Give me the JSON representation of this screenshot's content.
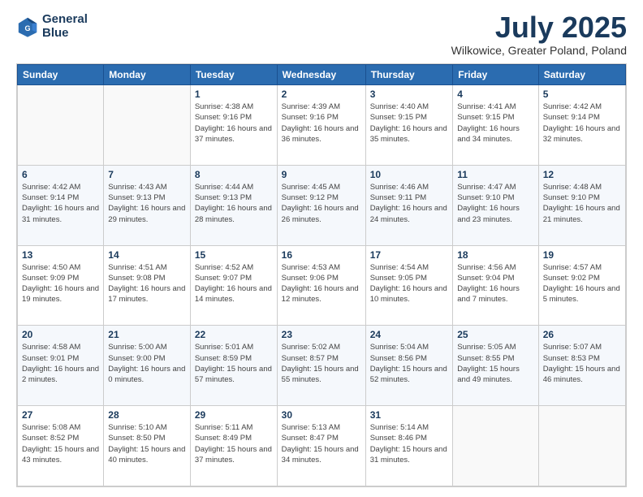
{
  "logo": {
    "line1": "General",
    "line2": "Blue"
  },
  "title": "July 2025",
  "location": "Wilkowice, Greater Poland, Poland",
  "days_of_week": [
    "Sunday",
    "Monday",
    "Tuesday",
    "Wednesday",
    "Thursday",
    "Friday",
    "Saturday"
  ],
  "weeks": [
    [
      {
        "day": "",
        "info": ""
      },
      {
        "day": "",
        "info": ""
      },
      {
        "day": "1",
        "info": "Sunrise: 4:38 AM\nSunset: 9:16 PM\nDaylight: 16 hours and 37 minutes."
      },
      {
        "day": "2",
        "info": "Sunrise: 4:39 AM\nSunset: 9:16 PM\nDaylight: 16 hours and 36 minutes."
      },
      {
        "day": "3",
        "info": "Sunrise: 4:40 AM\nSunset: 9:15 PM\nDaylight: 16 hours and 35 minutes."
      },
      {
        "day": "4",
        "info": "Sunrise: 4:41 AM\nSunset: 9:15 PM\nDaylight: 16 hours and 34 minutes."
      },
      {
        "day": "5",
        "info": "Sunrise: 4:42 AM\nSunset: 9:14 PM\nDaylight: 16 hours and 32 minutes."
      }
    ],
    [
      {
        "day": "6",
        "info": "Sunrise: 4:42 AM\nSunset: 9:14 PM\nDaylight: 16 hours and 31 minutes."
      },
      {
        "day": "7",
        "info": "Sunrise: 4:43 AM\nSunset: 9:13 PM\nDaylight: 16 hours and 29 minutes."
      },
      {
        "day": "8",
        "info": "Sunrise: 4:44 AM\nSunset: 9:13 PM\nDaylight: 16 hours and 28 minutes."
      },
      {
        "day": "9",
        "info": "Sunrise: 4:45 AM\nSunset: 9:12 PM\nDaylight: 16 hours and 26 minutes."
      },
      {
        "day": "10",
        "info": "Sunrise: 4:46 AM\nSunset: 9:11 PM\nDaylight: 16 hours and 24 minutes."
      },
      {
        "day": "11",
        "info": "Sunrise: 4:47 AM\nSunset: 9:10 PM\nDaylight: 16 hours and 23 minutes."
      },
      {
        "day": "12",
        "info": "Sunrise: 4:48 AM\nSunset: 9:10 PM\nDaylight: 16 hours and 21 minutes."
      }
    ],
    [
      {
        "day": "13",
        "info": "Sunrise: 4:50 AM\nSunset: 9:09 PM\nDaylight: 16 hours and 19 minutes."
      },
      {
        "day": "14",
        "info": "Sunrise: 4:51 AM\nSunset: 9:08 PM\nDaylight: 16 hours and 17 minutes."
      },
      {
        "day": "15",
        "info": "Sunrise: 4:52 AM\nSunset: 9:07 PM\nDaylight: 16 hours and 14 minutes."
      },
      {
        "day": "16",
        "info": "Sunrise: 4:53 AM\nSunset: 9:06 PM\nDaylight: 16 hours and 12 minutes."
      },
      {
        "day": "17",
        "info": "Sunrise: 4:54 AM\nSunset: 9:05 PM\nDaylight: 16 hours and 10 minutes."
      },
      {
        "day": "18",
        "info": "Sunrise: 4:56 AM\nSunset: 9:04 PM\nDaylight: 16 hours and 7 minutes."
      },
      {
        "day": "19",
        "info": "Sunrise: 4:57 AM\nSunset: 9:02 PM\nDaylight: 16 hours and 5 minutes."
      }
    ],
    [
      {
        "day": "20",
        "info": "Sunrise: 4:58 AM\nSunset: 9:01 PM\nDaylight: 16 hours and 2 minutes."
      },
      {
        "day": "21",
        "info": "Sunrise: 5:00 AM\nSunset: 9:00 PM\nDaylight: 16 hours and 0 minutes."
      },
      {
        "day": "22",
        "info": "Sunrise: 5:01 AM\nSunset: 8:59 PM\nDaylight: 15 hours and 57 minutes."
      },
      {
        "day": "23",
        "info": "Sunrise: 5:02 AM\nSunset: 8:57 PM\nDaylight: 15 hours and 55 minutes."
      },
      {
        "day": "24",
        "info": "Sunrise: 5:04 AM\nSunset: 8:56 PM\nDaylight: 15 hours and 52 minutes."
      },
      {
        "day": "25",
        "info": "Sunrise: 5:05 AM\nSunset: 8:55 PM\nDaylight: 15 hours and 49 minutes."
      },
      {
        "day": "26",
        "info": "Sunrise: 5:07 AM\nSunset: 8:53 PM\nDaylight: 15 hours and 46 minutes."
      }
    ],
    [
      {
        "day": "27",
        "info": "Sunrise: 5:08 AM\nSunset: 8:52 PM\nDaylight: 15 hours and 43 minutes."
      },
      {
        "day": "28",
        "info": "Sunrise: 5:10 AM\nSunset: 8:50 PM\nDaylight: 15 hours and 40 minutes."
      },
      {
        "day": "29",
        "info": "Sunrise: 5:11 AM\nSunset: 8:49 PM\nDaylight: 15 hours and 37 minutes."
      },
      {
        "day": "30",
        "info": "Sunrise: 5:13 AM\nSunset: 8:47 PM\nDaylight: 15 hours and 34 minutes."
      },
      {
        "day": "31",
        "info": "Sunrise: 5:14 AM\nSunset: 8:46 PM\nDaylight: 15 hours and 31 minutes."
      },
      {
        "day": "",
        "info": ""
      },
      {
        "day": "",
        "info": ""
      }
    ]
  ]
}
